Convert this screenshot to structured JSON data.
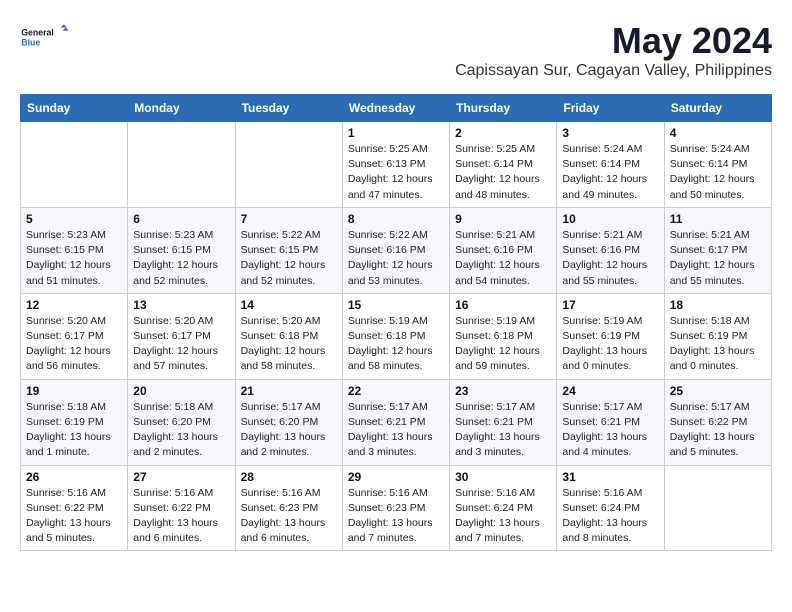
{
  "logo": {
    "general": "General",
    "blue": "Blue"
  },
  "title": "May 2024",
  "location": "Capissayan Sur, Cagayan Valley, Philippines",
  "days_header": [
    "Sunday",
    "Monday",
    "Tuesday",
    "Wednesday",
    "Thursday",
    "Friday",
    "Saturday"
  ],
  "weeks": [
    [
      {
        "day": "",
        "info": ""
      },
      {
        "day": "",
        "info": ""
      },
      {
        "day": "",
        "info": ""
      },
      {
        "day": "1",
        "info": "Sunrise: 5:25 AM\nSunset: 6:13 PM\nDaylight: 12 hours\nand 47 minutes."
      },
      {
        "day": "2",
        "info": "Sunrise: 5:25 AM\nSunset: 6:14 PM\nDaylight: 12 hours\nand 48 minutes."
      },
      {
        "day": "3",
        "info": "Sunrise: 5:24 AM\nSunset: 6:14 PM\nDaylight: 12 hours\nand 49 minutes."
      },
      {
        "day": "4",
        "info": "Sunrise: 5:24 AM\nSunset: 6:14 PM\nDaylight: 12 hours\nand 50 minutes."
      }
    ],
    [
      {
        "day": "5",
        "info": "Sunrise: 5:23 AM\nSunset: 6:15 PM\nDaylight: 12 hours\nand 51 minutes."
      },
      {
        "day": "6",
        "info": "Sunrise: 5:23 AM\nSunset: 6:15 PM\nDaylight: 12 hours\nand 52 minutes."
      },
      {
        "day": "7",
        "info": "Sunrise: 5:22 AM\nSunset: 6:15 PM\nDaylight: 12 hours\nand 52 minutes."
      },
      {
        "day": "8",
        "info": "Sunrise: 5:22 AM\nSunset: 6:16 PM\nDaylight: 12 hours\nand 53 minutes."
      },
      {
        "day": "9",
        "info": "Sunrise: 5:21 AM\nSunset: 6:16 PM\nDaylight: 12 hours\nand 54 minutes."
      },
      {
        "day": "10",
        "info": "Sunrise: 5:21 AM\nSunset: 6:16 PM\nDaylight: 12 hours\nand 55 minutes."
      },
      {
        "day": "11",
        "info": "Sunrise: 5:21 AM\nSunset: 6:17 PM\nDaylight: 12 hours\nand 55 minutes."
      }
    ],
    [
      {
        "day": "12",
        "info": "Sunrise: 5:20 AM\nSunset: 6:17 PM\nDaylight: 12 hours\nand 56 minutes."
      },
      {
        "day": "13",
        "info": "Sunrise: 5:20 AM\nSunset: 6:17 PM\nDaylight: 12 hours\nand 57 minutes."
      },
      {
        "day": "14",
        "info": "Sunrise: 5:20 AM\nSunset: 6:18 PM\nDaylight: 12 hours\nand 58 minutes."
      },
      {
        "day": "15",
        "info": "Sunrise: 5:19 AM\nSunset: 6:18 PM\nDaylight: 12 hours\nand 58 minutes."
      },
      {
        "day": "16",
        "info": "Sunrise: 5:19 AM\nSunset: 6:18 PM\nDaylight: 12 hours\nand 59 minutes."
      },
      {
        "day": "17",
        "info": "Sunrise: 5:19 AM\nSunset: 6:19 PM\nDaylight: 13 hours\nand 0 minutes."
      },
      {
        "day": "18",
        "info": "Sunrise: 5:18 AM\nSunset: 6:19 PM\nDaylight: 13 hours\nand 0 minutes."
      }
    ],
    [
      {
        "day": "19",
        "info": "Sunrise: 5:18 AM\nSunset: 6:19 PM\nDaylight: 13 hours\nand 1 minute."
      },
      {
        "day": "20",
        "info": "Sunrise: 5:18 AM\nSunset: 6:20 PM\nDaylight: 13 hours\nand 2 minutes."
      },
      {
        "day": "21",
        "info": "Sunrise: 5:17 AM\nSunset: 6:20 PM\nDaylight: 13 hours\nand 2 minutes."
      },
      {
        "day": "22",
        "info": "Sunrise: 5:17 AM\nSunset: 6:21 PM\nDaylight: 13 hours\nand 3 minutes."
      },
      {
        "day": "23",
        "info": "Sunrise: 5:17 AM\nSunset: 6:21 PM\nDaylight: 13 hours\nand 3 minutes."
      },
      {
        "day": "24",
        "info": "Sunrise: 5:17 AM\nSunset: 6:21 PM\nDaylight: 13 hours\nand 4 minutes."
      },
      {
        "day": "25",
        "info": "Sunrise: 5:17 AM\nSunset: 6:22 PM\nDaylight: 13 hours\nand 5 minutes."
      }
    ],
    [
      {
        "day": "26",
        "info": "Sunrise: 5:16 AM\nSunset: 6:22 PM\nDaylight: 13 hours\nand 5 minutes."
      },
      {
        "day": "27",
        "info": "Sunrise: 5:16 AM\nSunset: 6:22 PM\nDaylight: 13 hours\nand 6 minutes."
      },
      {
        "day": "28",
        "info": "Sunrise: 5:16 AM\nSunset: 6:23 PM\nDaylight: 13 hours\nand 6 minutes."
      },
      {
        "day": "29",
        "info": "Sunrise: 5:16 AM\nSunset: 6:23 PM\nDaylight: 13 hours\nand 7 minutes."
      },
      {
        "day": "30",
        "info": "Sunrise: 5:16 AM\nSunset: 6:24 PM\nDaylight: 13 hours\nand 7 minutes."
      },
      {
        "day": "31",
        "info": "Sunrise: 5:16 AM\nSunset: 6:24 PM\nDaylight: 13 hours\nand 8 minutes."
      },
      {
        "day": "",
        "info": ""
      }
    ]
  ]
}
